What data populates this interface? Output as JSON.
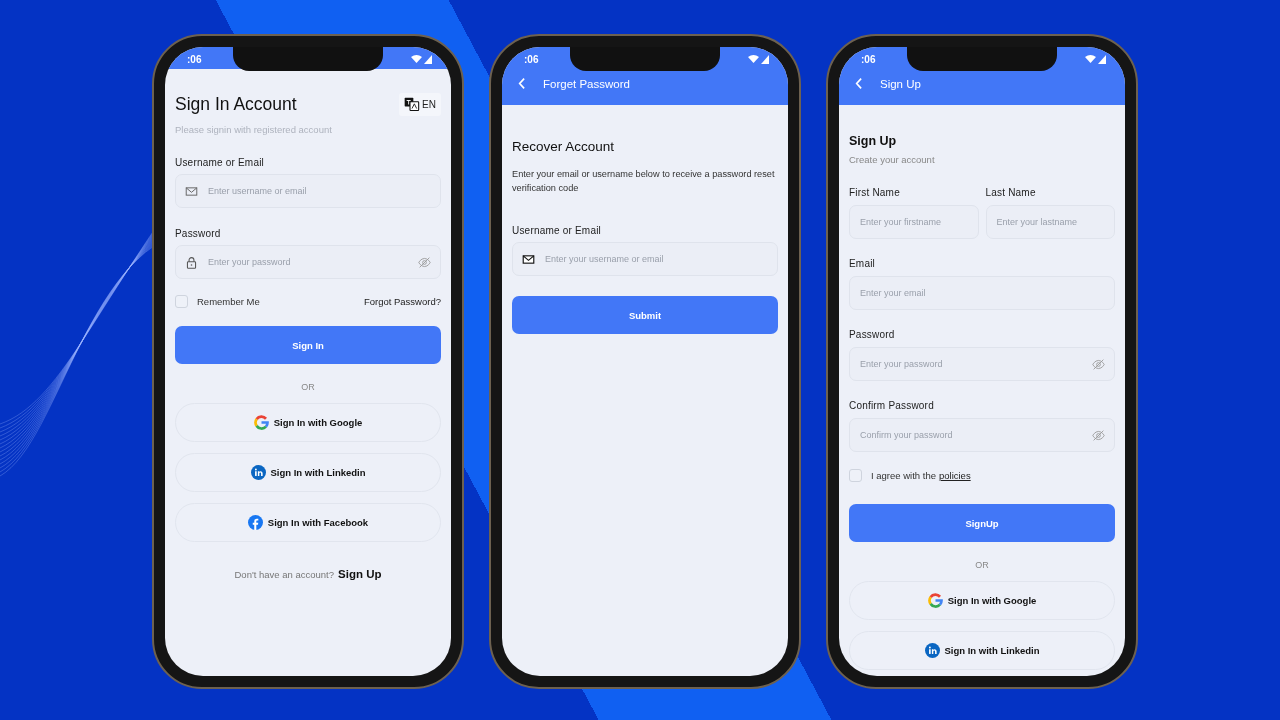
{
  "sign_in_screen": {
    "status_time": ":06",
    "title": "Sign In Account",
    "language": "EN",
    "subtitle": "Please signin with registered account",
    "fields": [
      {
        "label": "Username or Email",
        "placeholder": "Enter username or email",
        "kind": "email"
      },
      {
        "label": "Password",
        "placeholder": "Enter your password",
        "kind": "password"
      }
    ],
    "remember": {
      "label": "Remember Me",
      "checked": false
    },
    "forgot_link": "Forgot Password?",
    "submit": "Sign In",
    "divider": "OR",
    "social": [
      {
        "label": "Sign In with Google",
        "kind": "google"
      },
      {
        "label": "Sign In with Linkedin",
        "kind": "linkedin"
      },
      {
        "label": "Sign In with Facebook",
        "kind": "facebook"
      }
    ],
    "footer_text": "Don't have an account?",
    "footer_link": "Sign Up"
  },
  "forget_password_screen": {
    "status_time": ":06",
    "header_title": "Forget Password",
    "heading": "Recover Account",
    "description": "Enter your email or username below to receive a password reset verification code",
    "field": {
      "label": "Username or Email",
      "placeholder": "Enter your username or email",
      "kind": "email"
    },
    "submit": "Submit"
  },
  "sign_up_screen": {
    "status_time": ":06",
    "header_title": "Sign Up",
    "heading": "Sign Up",
    "subtitle": "Create your account",
    "name_fields": [
      {
        "label": "First Name",
        "placeholder": "Enter your firstname"
      },
      {
        "label": "Last Name",
        "placeholder": "Enter your lastname"
      }
    ],
    "fields": [
      {
        "label": "Email",
        "placeholder": "Enter your email",
        "kind": "plain"
      },
      {
        "label": "Password",
        "placeholder": "Enter your password",
        "kind": "secret"
      },
      {
        "label": "Confirm Password",
        "placeholder": "Confirm your password",
        "kind": "secret"
      }
    ],
    "agree": {
      "text": "I agree with the",
      "link": "policies",
      "checked": false
    },
    "submit": "SignUp",
    "divider": "OR",
    "social": [
      {
        "label": "Sign In with Google",
        "kind": "google"
      },
      {
        "label": "Sign In with Linkedin",
        "kind": "linkedin"
      }
    ]
  }
}
